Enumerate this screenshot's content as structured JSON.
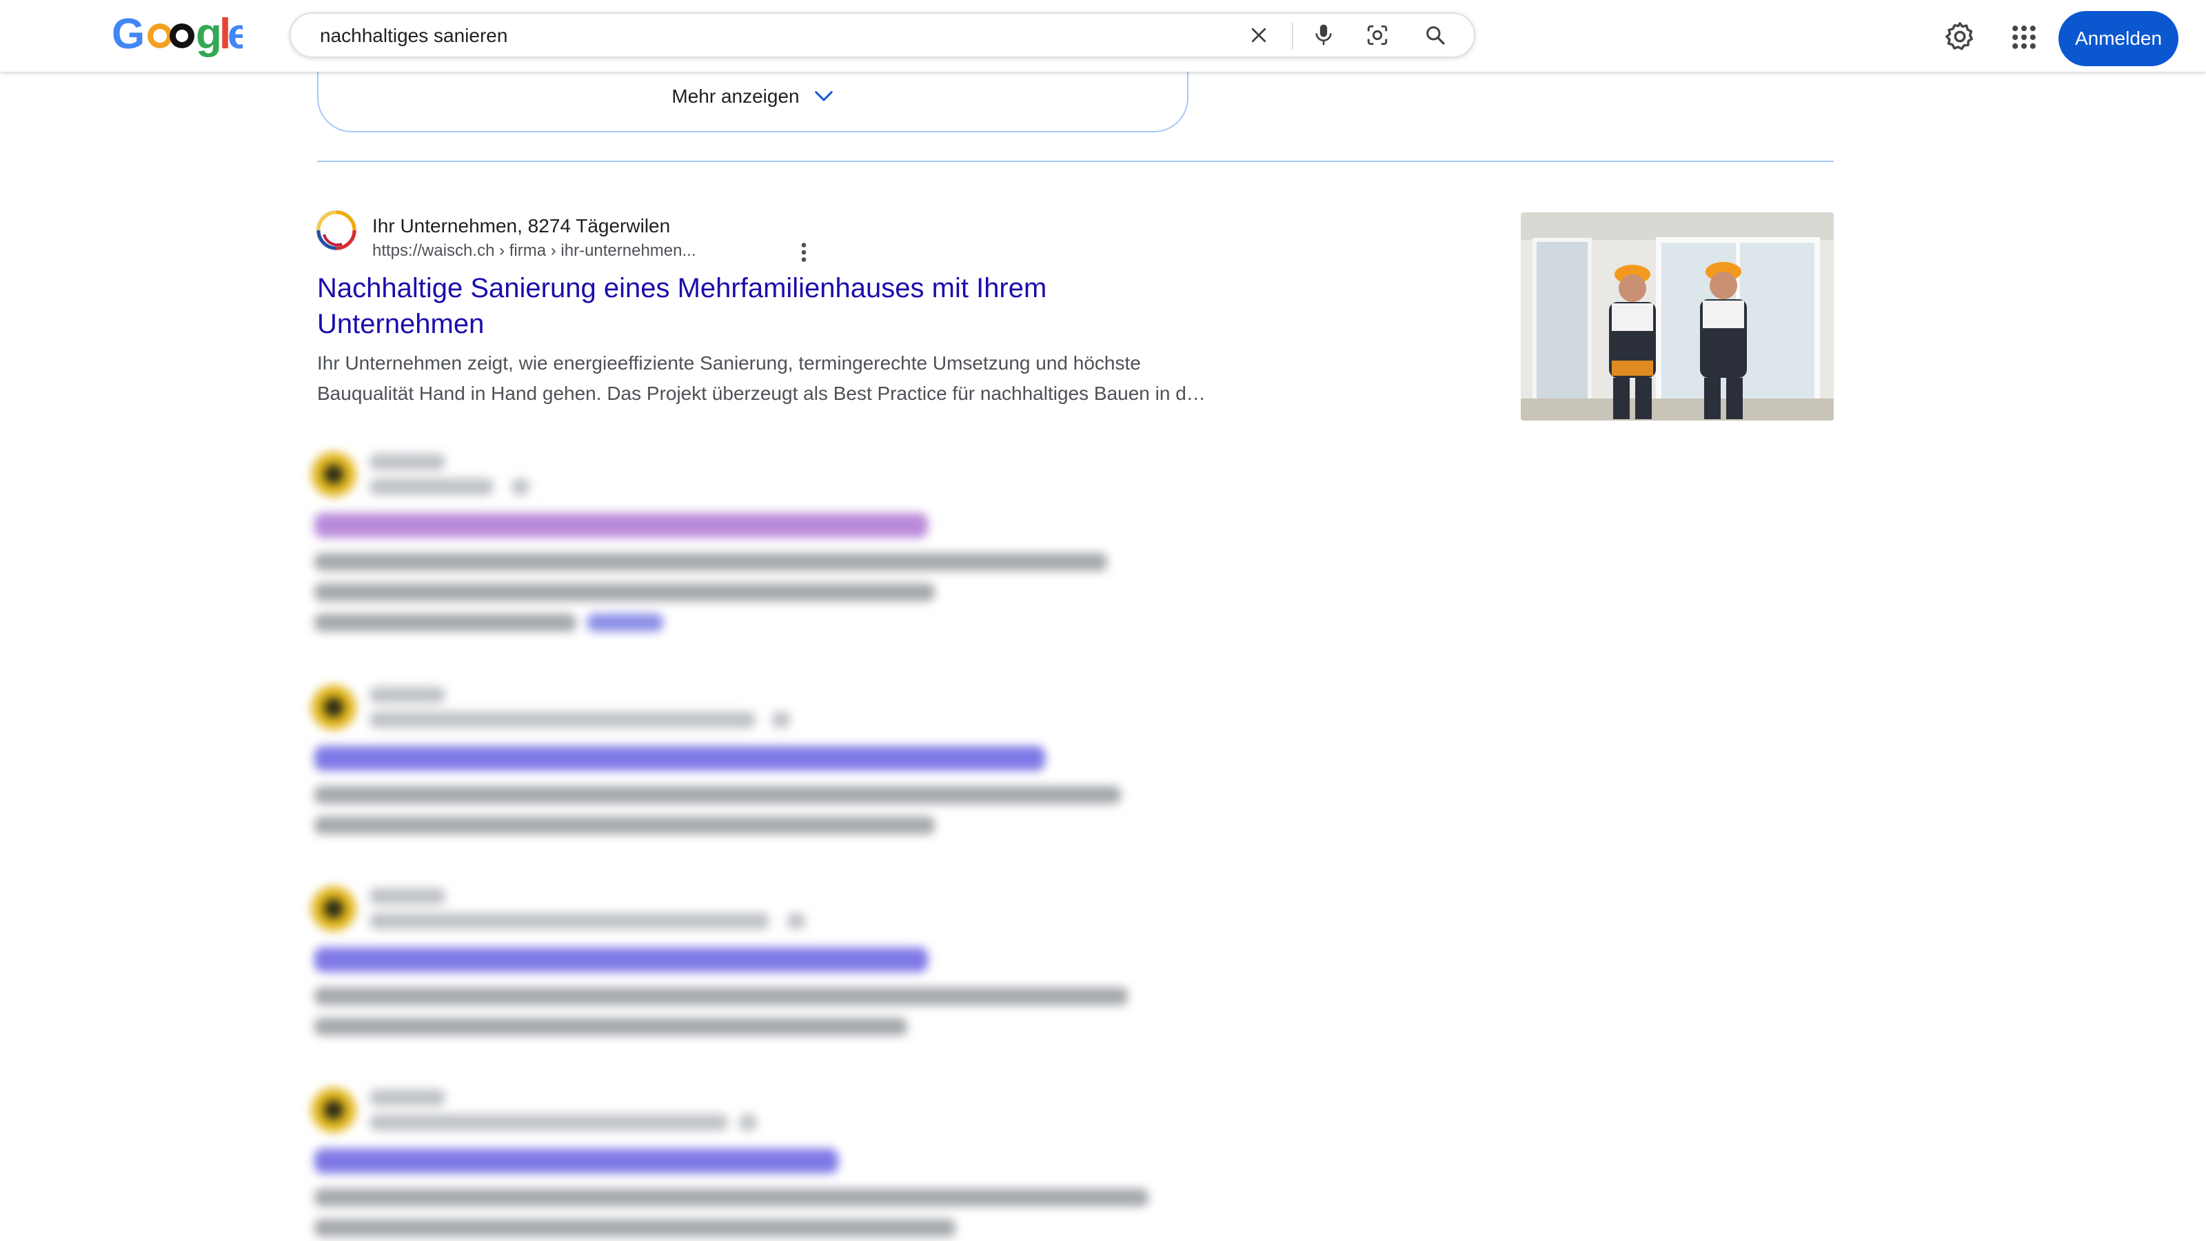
{
  "header": {
    "logo_text": "Google",
    "search_query": "nachhaltiges sanieren",
    "signin_label": "Anmelden",
    "colors": {
      "accent": "#0b57d0"
    },
    "icons": [
      "clear-icon",
      "microphone-icon",
      "lens-icon",
      "search-icon",
      "settings-icon",
      "apps-icon"
    ]
  },
  "show_more": {
    "label": "Mehr anzeigen",
    "icon": "chevron-down-icon"
  },
  "results": [
    {
      "site_name": "Ihr Unternehmen, 8274 Tägerwilen",
      "url": "https://waisch.ch › firma › ihr-unternehmen...",
      "title": "Nachhaltige Sanierung eines Mehrfamilienhauses mit Ihrem Unternehmen",
      "snippet": "Ihr Unternehmen zeigt, wie energieeffiziente Sanierung, termingerechte Umsetzung und höchste Bauqualität Hand in Hand gehen. Das Projekt überzeugt als Best Practice für nachhaltiges Bauen in d…",
      "thumbnail": "two construction workers in hard hats"
    }
  ]
}
